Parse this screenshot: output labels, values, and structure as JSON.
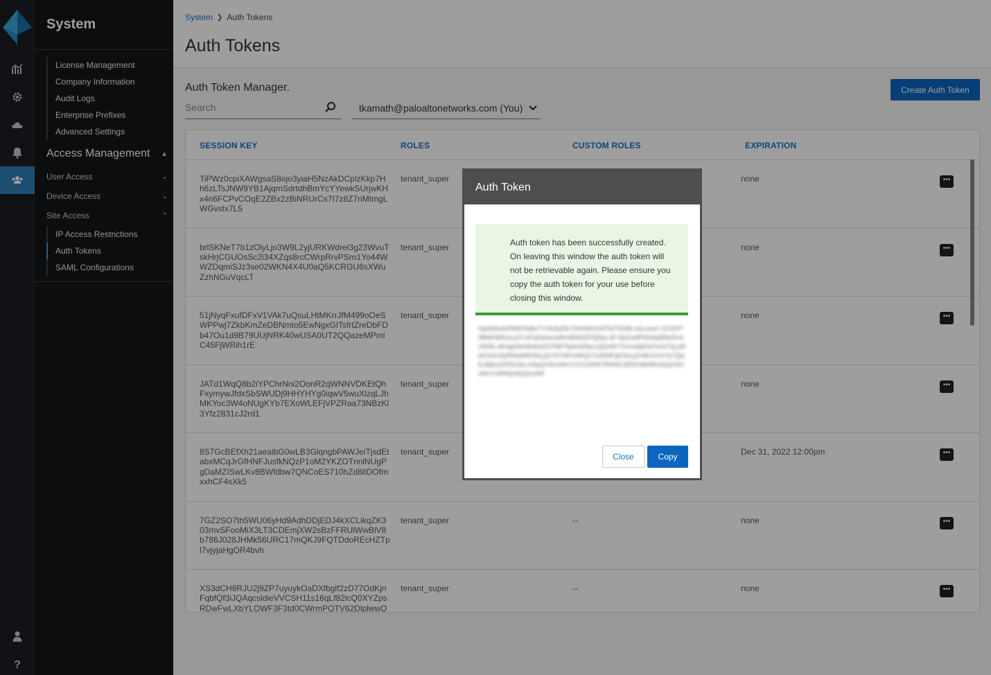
{
  "sidebar": {
    "title": "System",
    "system_items": [
      "License Management",
      "Company Information",
      "Audit Logs",
      "Enterprise Prefixes",
      "Advanced Settings"
    ],
    "access_management": "Access Management",
    "user_access": "User Access",
    "device_access": "Device Access",
    "site_access": "Site Access",
    "site_items": [
      "IP Access Restrictions",
      "Auth Tokens",
      "SAML Configurations"
    ]
  },
  "rail_icons": [
    "dashboard-icon",
    "gear-icon",
    "cloud-icon",
    "bell-icon",
    "users-icon",
    "user-icon",
    "help-icon"
  ],
  "breadcrumb": {
    "parent": "System",
    "current": "Auth Tokens"
  },
  "page_title": "Auth Tokens",
  "manager_title": "Auth Token Manager.",
  "search": {
    "placeholder": "Search",
    "value": ""
  },
  "user_filter": "tkamath@paloaltonetworks.com (You)",
  "create_button": "Create Auth Token",
  "table": {
    "headers": [
      "SESSION KEY",
      "ROLES",
      "CUSTOM ROLES",
      "EXPIRATION"
    ],
    "rows": [
      {
        "key": "TiPWz0cpiXAWgsaS8ojo3yiaH5NzAkDCplzKkp7Hh6zLTsJNW9YB1AjqmSdrtdhBmYcYYewkSUrjwKHx4n6FCPvCOqE2ZBx2zBiNRUrCs7I7z8Z7nMtmgLWGvstx7L5",
        "role": "tenant_super",
        "custom": "",
        "exp": "none"
      },
      {
        "key": "brlSKNeT7b1zOlyLjo3W9L2yjURKWdrel3g23WvuTskHrjCGUOsSc2i34XZqs8rcCWrpRrvPSro1Yo44WWZDqmiSJz3se02WKN4X4U0aQ5KCRGU6sXWuZzhNGuVqcLT",
        "role": "tenant_super",
        "custom": "",
        "exp": "none"
      },
      {
        "key": "51jNyqFxufDFxV1VAk7uQsuLHtMKrrJfM499oOeSWPPwj7ZkbKmZeDBNmto5EwNgxGITsfrtZreDbFDb47Ou1d9B79UUjNRK40wUSA0UT2QQazeMPmlC45FjWRih1rE",
        "role": "tenant_super",
        "custom": "",
        "exp": "none"
      },
      {
        "key": "JATd1WqQ8b2iYPChrNni2OonR2qWNNVDKEtQhFxymywJfdxSbSWUDj9HHYHYg0iqwV5wuXlzqLJhMKYoc3W4oNUgKYb7EXoWLEFjVPZRaa73NBzKl3Yfz2831cJ2rd1",
        "role": "tenant_super",
        "custom": "",
        "exp": "none"
      },
      {
        "key": "8S7GcBEfXh21aeaibG0wLB3GlqngbPAWJeiTjsdEtabxMCqJrGfHNFJusfkNQzP1oM2YKZOTnnlNUgPgDaMZISwLKv8BWfdbw7QNCoES710hZd8itDOfmxxhCF4sXk5",
        "role": "tenant_super",
        "custom": "",
        "exp": "Dec 31, 2022 12:00pm"
      },
      {
        "key": "7GZ2SO7th5WU06yHd9AdhDDjEDJ4kXCLikqZK303mvSFooMiX3LT3CDEmjXW2sBzFFRUlWwBlV8b786J028JHMk56URC17mQKJ9FQTDdoREcHZTpl7vjyjaHgOR4bvh",
        "role": "tenant_super",
        "custom": "--",
        "exp": "none"
      },
      {
        "key": "XS3dCH8RJU2j9ZP7uyuykOaDXfbglf2zD77OdKjnFqbfQf3iJQAqcsldieVVCSH11s16qLf82icQ0XYZpsRDwFwLXbYLOWF3F3td0CWrmPQTV62DlplwwQ",
        "role": "tenant_super",
        "custom": "--",
        "exp": "none"
      }
    ]
  },
  "modal": {
    "title": "Auth Token",
    "message": "Auth token has been successfully created. On leaving this window the auth token will not be retrievable again. Please ensure you copy the auth token for your use before closing this window.",
    "token": "hqwDbndsR8dHSdbx7YUkdqZ9c7bHHAHGAT5ZT5Zdb-xkLcswrr-1GXKlT9BMHWNrxLpTt-dFqNq4wrwMmBNtt3ZPQ5ky-dF-ByhmtfPN4dtqMNxRmtVtfr5lL-6K4gtSkhWdtvkZ4T9W7bjWJsRpLtcjQmRr7XnVw8pDcFzHsTqLyMbK2vDx5pRtNqWfG8sLjZcVhYkPmNbQrTx3WdFgK9sLpZvMcXnHrTy7QwEuBjKa2DfGhJkLmNpQrStUvWxYz0123456789AbCdEfGhIjKlMnOpQrStUvWxYzMNtQr8sZpLkWf",
    "close": "Close",
    "copy": "Copy"
  },
  "colors": {
    "accent": "#0c65bf",
    "sidebar": "#141619",
    "success": "#3a9a3a"
  }
}
